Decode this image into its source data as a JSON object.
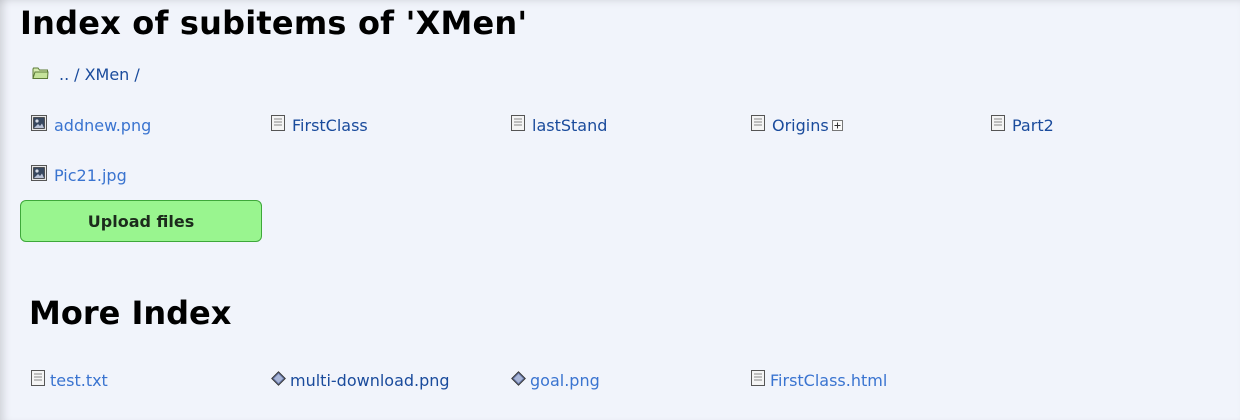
{
  "page_title": "Index of subitems of 'XMen'",
  "breadcrumb": {
    "parent": "..",
    "separator": "/",
    "current": "XMen",
    "trailing_separator": "/"
  },
  "items": [
    {
      "label": "addnew.png",
      "icon": "image-file-icon",
      "style": "light"
    },
    {
      "label": "FirstClass",
      "icon": "document-icon",
      "style": "dark"
    },
    {
      "label": "lastStand",
      "icon": "document-icon",
      "style": "dark"
    },
    {
      "label": "Origins",
      "icon": "document-icon",
      "style": "dark",
      "expandable": true
    },
    {
      "label": "Part2",
      "icon": "document-icon",
      "style": "dark"
    },
    {
      "label": "Pic21.jpg",
      "icon": "image-file-icon",
      "style": "light"
    }
  ],
  "upload_button": "Upload files",
  "more_section": {
    "title": "More Index",
    "items": [
      {
        "label": "test.txt",
        "icon": "document-icon",
        "style": "light"
      },
      {
        "label": "multi-download.png",
        "icon": "diamond-icon",
        "style": "dark"
      },
      {
        "label": "goal.png",
        "icon": "diamond-icon",
        "style": "light"
      },
      {
        "label": "FirstClass.html",
        "icon": "document-icon",
        "style": "light"
      }
    ]
  },
  "colors": {
    "background": "#f1f4fb",
    "link_light": "#3a74d0",
    "link_dark": "#1a4b9c",
    "upload_button_bg": "#99f58f",
    "upload_button_border": "#3ea83a"
  }
}
